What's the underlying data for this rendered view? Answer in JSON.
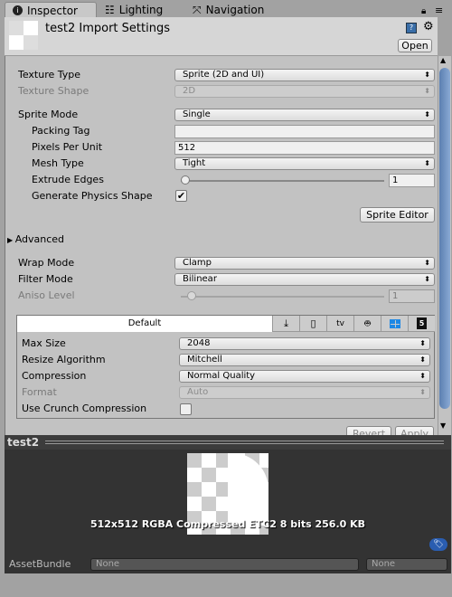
{
  "tabs": [
    {
      "label": "Inspector",
      "icon": "info-icon"
    },
    {
      "label": "Lighting",
      "icon": "lighting-icon"
    },
    {
      "label": "Navigation",
      "icon": "navigation-icon"
    }
  ],
  "header": {
    "title": "test2 Import Settings",
    "open_label": "Open"
  },
  "fields": {
    "texture_type": {
      "label": "Texture Type",
      "value": "Sprite (2D and UI)"
    },
    "texture_shape": {
      "label": "Texture Shape",
      "value": "2D"
    },
    "sprite_mode": {
      "label": "Sprite Mode",
      "value": "Single"
    },
    "packing_tag": {
      "label": "Packing Tag",
      "value": ""
    },
    "pixels_per_unit": {
      "label": "Pixels Per Unit",
      "value": "512"
    },
    "mesh_type": {
      "label": "Mesh Type",
      "value": "Tight"
    },
    "extrude_edges": {
      "label": "Extrude Edges",
      "value": "1"
    },
    "physics_shape": {
      "label": "Generate Physics Shape",
      "checked": true
    },
    "sprite_editor": "Sprite Editor",
    "advanced": "Advanced",
    "wrap_mode": {
      "label": "Wrap Mode",
      "value": "Clamp"
    },
    "filter_mode": {
      "label": "Filter Mode",
      "value": "Bilinear"
    },
    "aniso_level": {
      "label": "Aniso Level",
      "value": "1"
    }
  },
  "platform": {
    "default_tab": "Default",
    "icons": [
      "download-icon",
      "phone-icon",
      "appletv-icon",
      "android-icon",
      "windows-icon",
      "html5-icon"
    ],
    "appletv_text": "tv",
    "max_size": {
      "label": "Max Size",
      "value": "2048"
    },
    "resize": {
      "label": "Resize Algorithm",
      "value": "Mitchell"
    },
    "compression": {
      "label": "Compression",
      "value": "Normal Quality"
    },
    "format": {
      "label": "Format",
      "value": "Auto"
    },
    "crunch": {
      "label": "Use Crunch Compression",
      "checked": false
    }
  },
  "actions": {
    "revert": "Revert",
    "apply": "Apply"
  },
  "preview": {
    "title": "test2",
    "info": "512x512  RGBA Compressed ETC2 8 bits   256.0 KB"
  },
  "assetbundle": {
    "label": "AssetBundle",
    "name": "None",
    "variant": "None"
  }
}
